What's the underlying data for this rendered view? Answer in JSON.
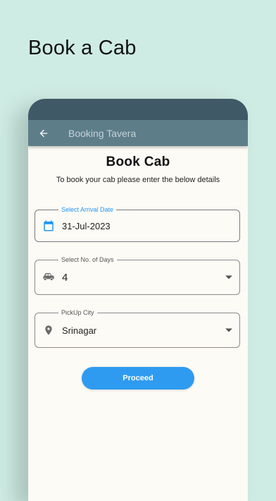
{
  "promo": {
    "title": "Book a Cab"
  },
  "app_bar": {
    "title": "Booking Tavera",
    "back_icon": "arrow-left-icon"
  },
  "form": {
    "heading": "Book Cab",
    "subtitle": "To book your cab please enter the below details",
    "arrival_date": {
      "label": "Select Arrival Date",
      "value": "31-Jul-2023",
      "icon": "calendar-icon"
    },
    "days": {
      "label": "Select No. of Days",
      "value": "4",
      "icon": "car-icon"
    },
    "pickup_city": {
      "label": "PickUp City",
      "value": "Srinagar",
      "icon": "location-pin-icon"
    },
    "proceed_label": "Proceed"
  },
  "colors": {
    "background": "#cfece4",
    "status_bar": "#3f5a66",
    "app_bar": "#5d7d89",
    "accent": "#2f9bf0",
    "card": "#fdfbf5"
  }
}
